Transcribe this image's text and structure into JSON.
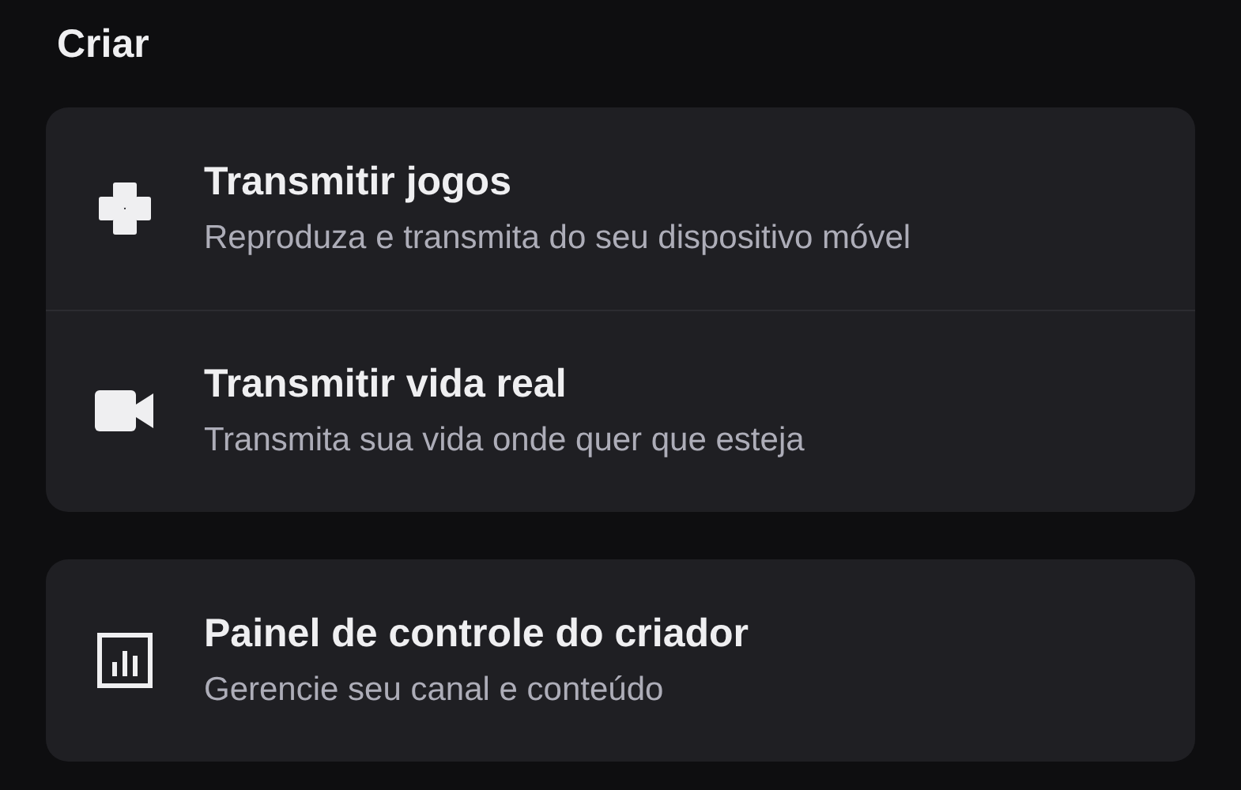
{
  "heading": "Criar",
  "cards": [
    {
      "items": [
        {
          "title": "Transmitir jogos",
          "subtitle": "Reproduza e transmita do seu dispositivo móvel"
        },
        {
          "title": "Transmitir vida real",
          "subtitle": "Transmita sua vida onde quer que esteja"
        }
      ]
    },
    {
      "items": [
        {
          "title": "Painel de controle do criador",
          "subtitle": "Gerencie seu canal e conteúdo"
        }
      ]
    }
  ]
}
